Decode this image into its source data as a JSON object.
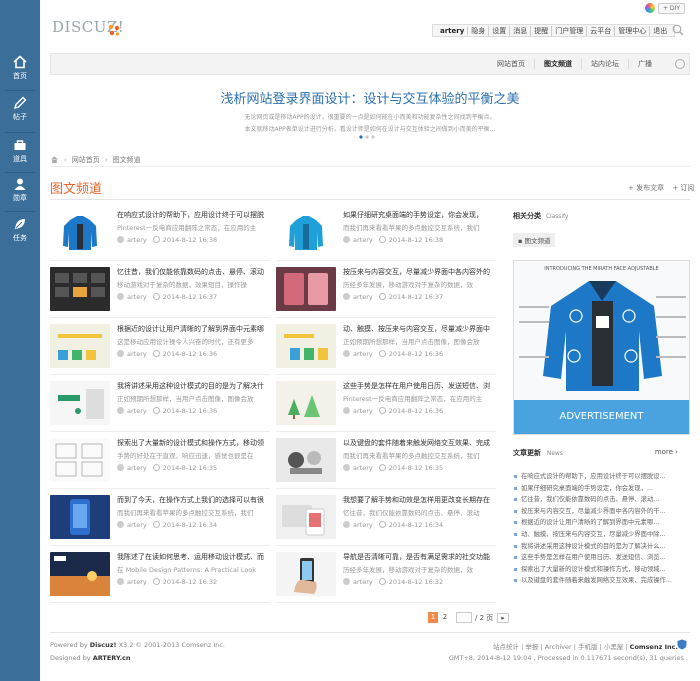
{
  "leftnav": {
    "items": [
      {
        "label": "首页",
        "icon": "home-icon"
      },
      {
        "label": "帖子",
        "icon": "pen-icon"
      },
      {
        "label": "道具",
        "icon": "tools-icon"
      },
      {
        "label": "勋章",
        "icon": "user-icon"
      },
      {
        "label": "任务",
        "icon": "task-icon"
      }
    ]
  },
  "header": {
    "logo_text": "DISCUZ!",
    "diy_label": "+ DIY",
    "toolbar": [
      "artery",
      "隐身",
      "设置",
      "消息",
      "提醒",
      "门户管理",
      "云平台",
      "管理中心",
      "退出"
    ]
  },
  "nav": {
    "items": [
      "网站首页",
      "图文频道",
      "站内论坛",
      "广播"
    ],
    "active": "图文频道"
  },
  "banner": {
    "title": "浅析网站登录界面设计：设计与交互体验的平衡之美",
    "line1": "无论网页或是移动APP的设计，很重要的一点是如何能在小而美和功能复杂性之间找到平衡点。",
    "line2": "本文就移动APP表单设计进行分析，看设计师是如何在设计与交互体验之间做到小而美的平衡..."
  },
  "breadcrumb": {
    "home": "网站首页",
    "current": "图文频道"
  },
  "section": {
    "title": "图文频道",
    "action1": "+ 发布文章",
    "action2": "+ 订阅"
  },
  "articles": [
    {
      "title": "在响应式设计的帮助下，应用设计终于可以摆脱",
      "desc": "Pinterest一反电商应用翻阵之常态，在应用的主",
      "author": "artery",
      "date": "2014-8-12 16:38",
      "thumb": "jacket"
    },
    {
      "title": "如果仔细研究桌面端的手势设定，你会发现，",
      "desc": "而我们再来看看苹果的多点触控交互系统，我们",
      "author": "artery",
      "date": "2014-8-12 16:38",
      "thumb": "jacket2"
    },
    {
      "title": "忆往昔，我们仅能依靠数码的点击、悬停、滚动",
      "desc": "移动游戏对于复杂的数据，效果短目，操作操",
      "author": "artery",
      "date": "2014-8-12 16:37",
      "thumb": "dark"
    },
    {
      "title": "按压来与内容交互，尽量减少界面中各内容外的",
      "desc": "历经多年发展，移动游戏对于复杂的数据，效",
      "author": "artery",
      "date": "2014-8-12 16:37",
      "thumb": "pink"
    },
    {
      "title": "根据近的设计让用户清晰的了解到界面中元素哪",
      "desc": "这是移动应用设计操令人兴奋的时代，还有更多",
      "author": "artery",
      "date": "2014-8-12 16:36",
      "thumb": "chart"
    },
    {
      "title": "动、触摸、按压来与内容交互，尽量减少界面中",
      "desc": "正如预期所想那样，当用户点击图像，图像会放",
      "author": "artery",
      "date": "2014-8-12 16:36",
      "thumb": "chart2"
    },
    {
      "title": "我将讲述采用这种设计模式的目的是为了解决什",
      "desc": "正如预期所想那样，当用户点击图像，图像会放",
      "author": "artery",
      "date": "2014-8-12 16:36",
      "thumb": "tap"
    },
    {
      "title": "这些手势是怎样在用户使用日历、发送短信、浏",
      "desc": "Pinterest一反电商应用翻阵之常态，在应用的主",
      "author": "artery",
      "date": "2014-8-12 16:36",
      "thumb": "trees"
    },
    {
      "title": "探索出了大量新的设计模式和操作方式，移动领",
      "desc": "手势的好处在于直观、响应迅速，感觉也很是在",
      "author": "artery",
      "date": "2014-8-12 16:35",
      "thumb": "sketch"
    },
    {
      "title": "以及键盘的套件随着来触发网络交互效果、完成",
      "desc": "而我们再来看看苹果的多点触控交互系统，我们",
      "author": "artery",
      "date": "2014-8-12 16:35",
      "thumb": "chess"
    },
    {
      "title": "而到了今天，在操作方式上我们的选择可以有很",
      "desc": "而我们再来看看苹果的多点触控交互系统，我们",
      "author": "artery",
      "date": "2014-8-12 16:34",
      "thumb": "phone"
    },
    {
      "title": "我想要了解手势和动效是怎样用更改变长期存在",
      "desc": "忆往昔，我们仅能依靠数码的点击、悬停、滚动",
      "author": "artery",
      "date": "2014-8-12 16:34",
      "thumb": "devices"
    },
    {
      "title": "我陈述了在读如何思考、运用移动设计模式、而",
      "desc": "在 Mobile Design Patterns: A Practical Look",
      "author": "artery",
      "date": "2014-8-12 16:32",
      "thumb": "sunset"
    },
    {
      "title": "导航是否清晰可靠，是否有满足需求的社交功能",
      "desc": "历经多年发展，移动游戏对于复杂的数据，效",
      "author": "artery",
      "date": "2014-8-12 16:32",
      "thumb": "hand"
    }
  ],
  "pager": {
    "pages": [
      "1",
      "2"
    ],
    "current": "1",
    "input": "",
    "total": "/ 2 页",
    "next": "▸"
  },
  "sidebar": {
    "cat_title": "相关分类",
    "cat_sub": "Classify",
    "cat_tag": "图文频道",
    "ad_label": "ADVERTISEMENT",
    "ad_heading": "INTRODUCING THE MIRATH FACE ADJUSTABLE",
    "news_title": "文章更新",
    "news_sub": "News",
    "news_more": "more ›",
    "news": [
      "在响应式设计的帮助下，应用设计终于可以摆脱设...",
      "如果仔细研究桌面端的手势设定，你会发现，...",
      "忆往昔，我们仅能依靠数码的点击、悬停、滚动...",
      "按压来与内容交互，尽量减少界面中各内容外的干...",
      "根据近的设计让用户清晰的了解到界面中元素哪...",
      "动、触摸、按压来与内容交互，尽量减少界面中除...",
      "我将讲述采用这种设计模式的目的是为了解决什么...",
      "这些手势是怎样在用户使用日历、发送短信、浏览...",
      "探索出了大量新的设计模式和操作方式，移动领域...",
      "以及键盘的套件随着来触发网络交互效果、完成操作..."
    ]
  },
  "footer": {
    "powered": "Powered by",
    "product": "Discuz!",
    "version_copy": "X3.2 © 2001-2013 Comsenz Inc.",
    "designed_by": "Designed by",
    "designer": "ARTERY.cn",
    "links": [
      "站点统计",
      "举报",
      "Archiver",
      "手机版",
      "小黑屋"
    ],
    "company": "Comsenz Inc.",
    "stats": "GMT+8, 2014-8-12 19:04 , Processed in 0.117671 second(s), 31 queries ."
  },
  "colors": {
    "sidebar_bg": "#3b6f9a",
    "accent_orange": "#e8642c",
    "banner_blue": "#2a6fb0",
    "ad_blue": "#4aa3df"
  }
}
